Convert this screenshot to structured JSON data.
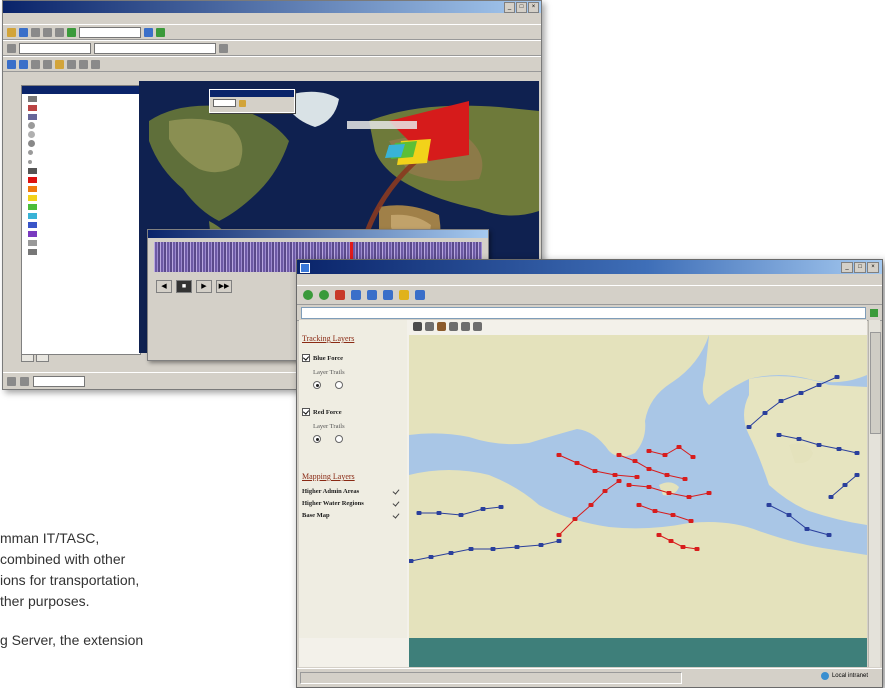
{
  "brochure_text": {
    "line1": "mman IT/TASC,",
    "line2": "combined with other",
    "line3": "ions for transportation,",
    "line4": "ther purposes.",
    "line5": "g Server, the extension"
  },
  "colors": {
    "title_bar": "#0a246a",
    "chrome": "#d4d0c8",
    "info_panel": "#3e7f7a",
    "layer_header": "#8a2a14",
    "track_red": "#d81c1c",
    "track_blue": "#2a3f9c"
  },
  "front_window": {
    "panel": {
      "tracking_layers_title": "Tracking Layers",
      "blue_force": "Blue Force",
      "red_force": "Red Force",
      "layer_trails": "Layer Trails",
      "mapping_layers_title": "Mapping Layers",
      "mapping_layers": [
        "Higher Admin Areas",
        "Higher Water Regions",
        "Base Map"
      ]
    },
    "status": {
      "zone": "Local intranet"
    }
  },
  "icons": [
    "app-icon",
    "minimize-icon",
    "maximize-icon",
    "close-icon",
    "back-icon",
    "forward-icon",
    "stop-icon",
    "refresh-icon",
    "home-icon",
    "search-icon",
    "favorites-icon",
    "history-icon",
    "go-icon",
    "zoom-in-icon",
    "zoom-out-icon",
    "pan-icon",
    "identify-icon",
    "play-icon",
    "stop-playback-icon"
  ]
}
